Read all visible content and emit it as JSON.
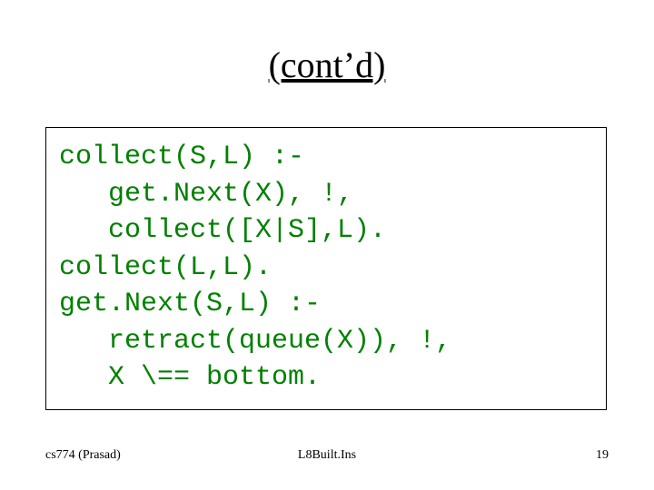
{
  "title": "(cont’d)",
  "code": {
    "l1": "collect(S,L) :-",
    "l2": "   get.Next(X), !,",
    "l3": "   collect([X|S],L).",
    "l4": "collect(L,L).",
    "l5": "get.Next(S,L) :-",
    "l6": "   retract(queue(X)), !,",
    "l7": "   X \\== bottom."
  },
  "footer": {
    "left": "cs774 (Prasad)",
    "center": "L8Built.Ins",
    "right": "19"
  }
}
